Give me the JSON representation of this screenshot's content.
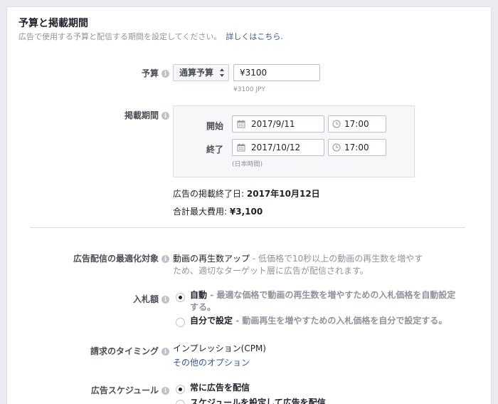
{
  "section": {
    "title": "予算と掲載期間",
    "subtitle": "広告で使用する予算と配信する期間を設定してください。",
    "learn_more": "詳しくはこちら."
  },
  "budget": {
    "label": "予算",
    "type_label": "通算予算",
    "amount": "¥3100",
    "hint": "¥3100 JPY"
  },
  "schedule": {
    "label": "掲載期間",
    "start_label": "開始",
    "start_date": "2017/9/11",
    "start_time": "17:00",
    "end_label": "終了",
    "end_date": "2017/10/12",
    "end_time": "17:00",
    "timezone": "(日本時間)"
  },
  "summary": {
    "end_date_label": "広告の掲載終了日:",
    "end_date_value": "2017年10月12日",
    "max_cost_label": "合計最大費用:",
    "max_cost_value": "¥3,100"
  },
  "optimization": {
    "label": "広告配信の最適化対象",
    "value": "動画の再生数アップ",
    "desc_1": " - 低価格で10秒以上の動画の再生数を増やす",
    "desc_2": "ため、適切なターゲット層に広告が配信されます。"
  },
  "bid": {
    "label": "入札額",
    "auto_title": "自動",
    "auto_desc_1": " - 最適な価格で動画の再生数を増やすための入札価格を自動設定",
    "auto_desc_2": "する。",
    "manual_title": "自分で設定",
    "manual_desc": " - 動画再生を増やすための入札価格を自分で設定する。"
  },
  "billing": {
    "label": "請求のタイミング",
    "value": "インプレッション(CPM)",
    "more_options": "その他のオプション"
  },
  "ad_schedule": {
    "label": "広告スケジュール",
    "always_on": "常に広告を配信",
    "custom": "スケジュールを設定して広告を配信"
  },
  "icons": {
    "info": "info-icon",
    "calendar": "calendar-icon",
    "clock": "clock-icon",
    "select_arrows": "updown-arrows-icon"
  }
}
